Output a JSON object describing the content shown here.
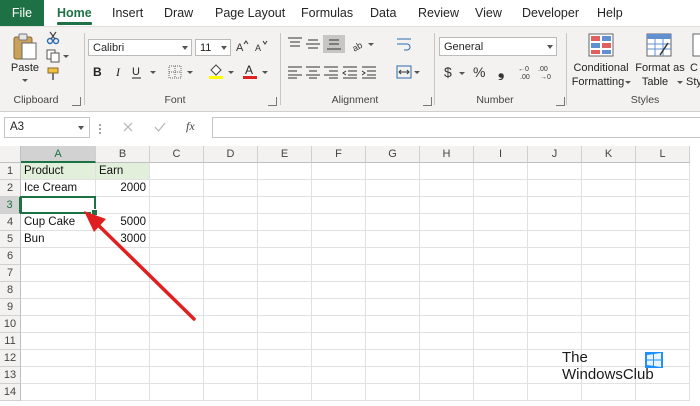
{
  "menu": {
    "tabs": [
      "File",
      "Home",
      "Insert",
      "Draw",
      "Page Layout",
      "Formulas",
      "Data",
      "Review",
      "View",
      "Developer",
      "Help"
    ],
    "active": "Home"
  },
  "ribbon": {
    "clipboard": {
      "paste_label": "Paste",
      "group_label": "Clipboard"
    },
    "font": {
      "name": "Calibri",
      "size": "11",
      "group_label": "Font"
    },
    "alignment": {
      "group_label": "Alignment"
    },
    "number": {
      "format": "General",
      "group_label": "Number"
    },
    "styles": {
      "conditional_line1": "Conditional",
      "conditional_line2": "Formatting",
      "format_table_line1": "Format as",
      "format_table_line2": "Table",
      "cell_styles_line1": "C",
      "cell_styles_line2": "Styl",
      "group_label": "Styles"
    }
  },
  "formula_bar": {
    "name_box": "A3",
    "fx_label": "fx",
    "formula": ""
  },
  "sheet": {
    "columns": [
      "A",
      "B",
      "C",
      "D",
      "E",
      "F",
      "G",
      "H",
      "I",
      "J",
      "K",
      "L"
    ],
    "rows": [
      "1",
      "2",
      "3",
      "4",
      "5",
      "6",
      "7",
      "8",
      "9",
      "10",
      "11",
      "12",
      "13",
      "14"
    ],
    "selected_cell": "A3",
    "cells": {
      "A1": "Product",
      "B1": "Earn",
      "A2": "Ice Cream",
      "B2": "2000",
      "A4": "Cup Cake",
      "B4": "5000",
      "A5": "Bun",
      "B5": "3000"
    }
  },
  "colors": {
    "accent": "#1e7145",
    "header_fill": "#e2efda",
    "arrow": "#e02020"
  },
  "watermark": {
    "line1": "The",
    "line2": "WindowsClub"
  }
}
